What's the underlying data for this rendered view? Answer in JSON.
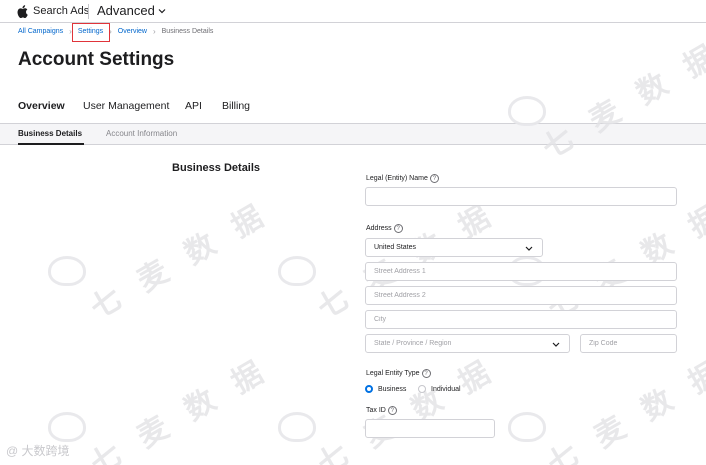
{
  "header": {
    "brand": "Search Ads",
    "product": "Advanced"
  },
  "breadcrumb": [
    "All Campaigns",
    "Settings",
    "Overview",
    "Business Details"
  ],
  "page_title": "Account Settings",
  "tabs": [
    "Overview",
    "User Management",
    "API",
    "Billing"
  ],
  "subtabs": [
    "Business Details",
    "Account Information"
  ],
  "section_title": "Business Details",
  "form": {
    "legal_name_label": "Legal (Entity) Name",
    "legal_name_value": "",
    "address_label": "Address",
    "country_value": "United States",
    "street1_placeholder": "Street Address 1",
    "street2_placeholder": "Street Address 2",
    "city_placeholder": "City",
    "state_placeholder": "State / Province / Region",
    "zip_placeholder": "Zip Code",
    "entity_type_label": "Legal Entity Type",
    "entity_options": [
      "Business",
      "Individual"
    ],
    "entity_selected": "Business",
    "tax_id_label": "Tax ID",
    "help_glyph": "?"
  },
  "watermark": {
    "text": "七 麦 数 据",
    "corner_text": "@ 大数跨境"
  },
  "colors": {
    "link": "#0066cc",
    "radio_selected": "#0071e3",
    "annotation_box": "#e0343a"
  }
}
